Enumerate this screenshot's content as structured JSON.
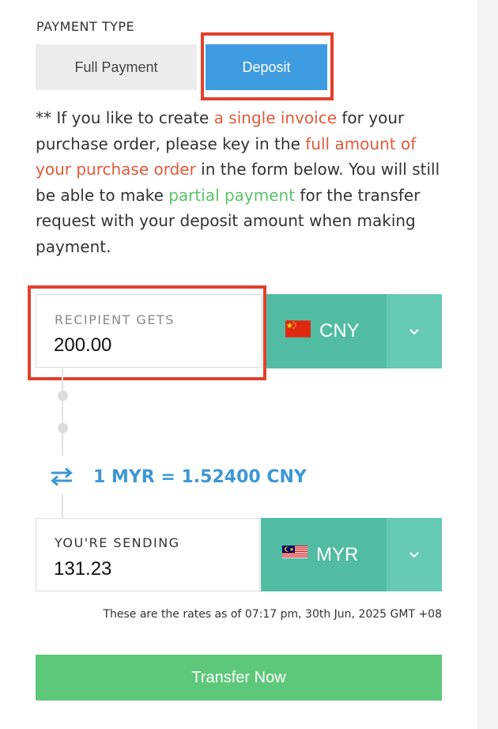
{
  "payment_type": {
    "label": "PAYMENT TYPE",
    "options": [
      "Full Payment",
      "Deposit"
    ],
    "selected": "Deposit"
  },
  "note": {
    "part1": "** If you like to create ",
    "link1": "a single invoice",
    "part2": " for your purchase order, please key in the ",
    "link2": "full amount of your purchase order",
    "part3": " in the form below. You will still be able to make ",
    "link3": "partial payment",
    "part4": " for the transfer request with your deposit amount when making payment."
  },
  "recipient": {
    "label": "RECIPIENT GETS",
    "amount": "200.00",
    "currency": "CNY",
    "flag_icon": "china-flag-icon"
  },
  "rate": {
    "text": "1 MYR = 1.52400 CNY",
    "icon": "swap-arrows-icon"
  },
  "sending": {
    "label": "YOU'RE SENDING",
    "amount": "131.23",
    "currency": "MYR",
    "flag_icon": "malaysia-flag-icon"
  },
  "rates_note": "These are the rates as of 07:17 pm, 30th Jun, 2025 GMT +08",
  "transfer_button": "Transfer Now",
  "colors": {
    "accent_blue": "#3f9be0",
    "teal": "#52bca3",
    "teal_light": "#66c9b6",
    "green_button": "#5ec87a",
    "highlight_red": "#e2402b",
    "link_red": "#e05a3a",
    "link_green": "#5cc26a"
  }
}
